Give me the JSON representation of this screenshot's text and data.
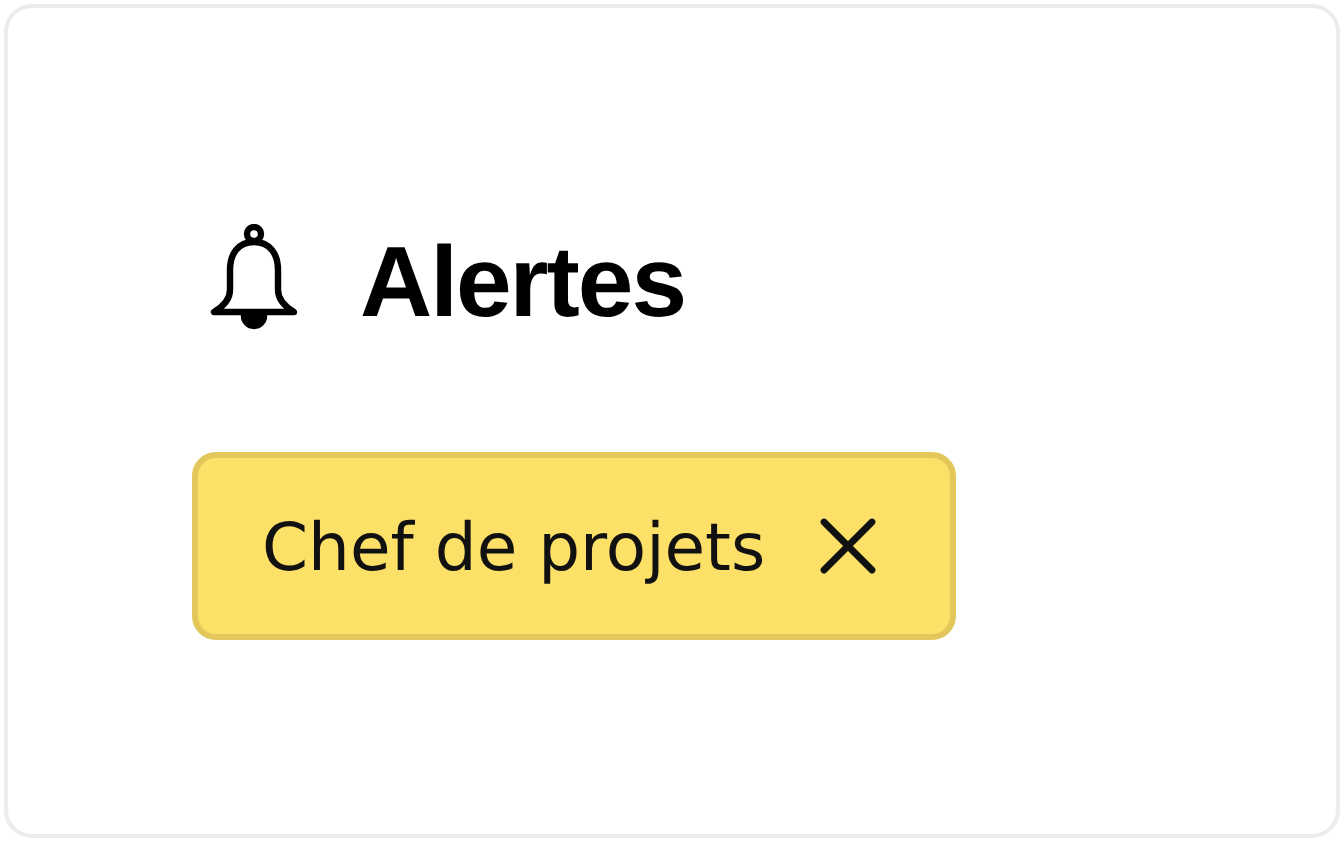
{
  "header": {
    "title": "Alertes"
  },
  "tags": [
    {
      "label": "Chef de projets",
      "removable": true
    }
  ]
}
